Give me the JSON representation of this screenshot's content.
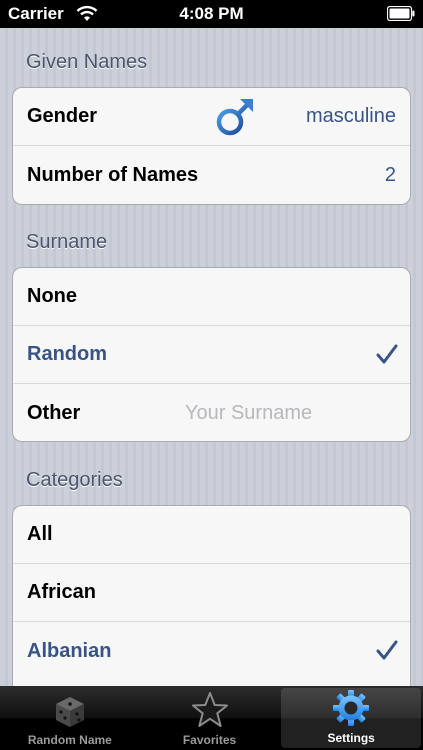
{
  "status_bar": {
    "carrier": "Carrier",
    "time": "4:08 PM"
  },
  "given_names": {
    "header": "Given Names",
    "rows": [
      {
        "label": "Gender",
        "value": "masculine",
        "icon": "male-symbol-icon"
      },
      {
        "label": "Number of Names",
        "value": "2"
      }
    ]
  },
  "surname": {
    "header": "Surname",
    "rows": [
      {
        "label": "None"
      },
      {
        "label": "Random",
        "checked": true
      },
      {
        "label": "Other",
        "placeholder": "Your Surname"
      }
    ]
  },
  "categories": {
    "header": "Categories",
    "rows": [
      {
        "label": "All"
      },
      {
        "label": "African"
      },
      {
        "label": "Albanian",
        "checked": true
      }
    ]
  },
  "tab_bar": {
    "tabs": [
      {
        "label": "Random Name",
        "icon": "dice-icon"
      },
      {
        "label": "Favorites",
        "icon": "star-icon"
      },
      {
        "label": "Settings",
        "icon": "gear-icon",
        "active": true
      }
    ]
  },
  "colors": {
    "accent": "#385487",
    "section_header": "#4c566c",
    "gender_icon": "#1f5fb3"
  }
}
